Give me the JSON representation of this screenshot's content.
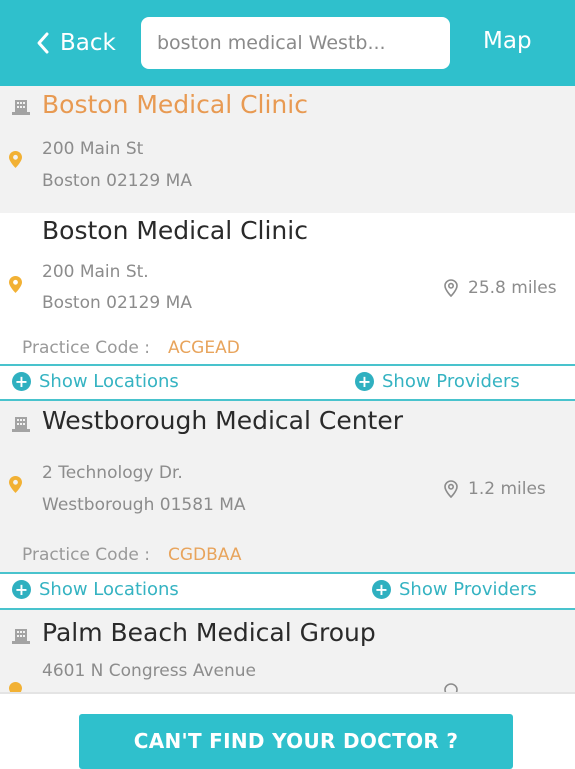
{
  "header": {
    "back_label": "Back",
    "search_value": "boston medical Westb...",
    "map_label": "Map"
  },
  "results": [
    {
      "name": "Boston Medical Clinic",
      "address_line1": "200 Main St",
      "address_line2": "Boston 02129 MA"
    },
    {
      "name": "Boston Medical Clinic",
      "address_line1": "200 Main St.",
      "address_line2": "Boston 02129 MA",
      "distance": "25.8 miles",
      "practice_code_label": "Practice Code :",
      "practice_code": "ACGEAD",
      "show_locations": "Show Locations",
      "show_providers": "Show Providers"
    },
    {
      "name": "Westborough Medical Center",
      "address_line1": "2 Technology Dr.",
      "address_line2": "Westborough 01581 MA",
      "distance": "1.2 miles",
      "practice_code_label": "Practice Code :",
      "practice_code": "CGDBAA",
      "show_locations": "Show Locations",
      "show_providers": "Show Providers"
    },
    {
      "name": "Palm Beach Medical Group",
      "address_line1": "4601 N Congress Avenue"
    }
  ],
  "footer": {
    "cta_label": "CAN'T FIND YOUR DOCTOR ?"
  },
  "colors": {
    "accent": "#2fc0cc",
    "orange": "#e89a52",
    "link": "#35b3c2"
  }
}
